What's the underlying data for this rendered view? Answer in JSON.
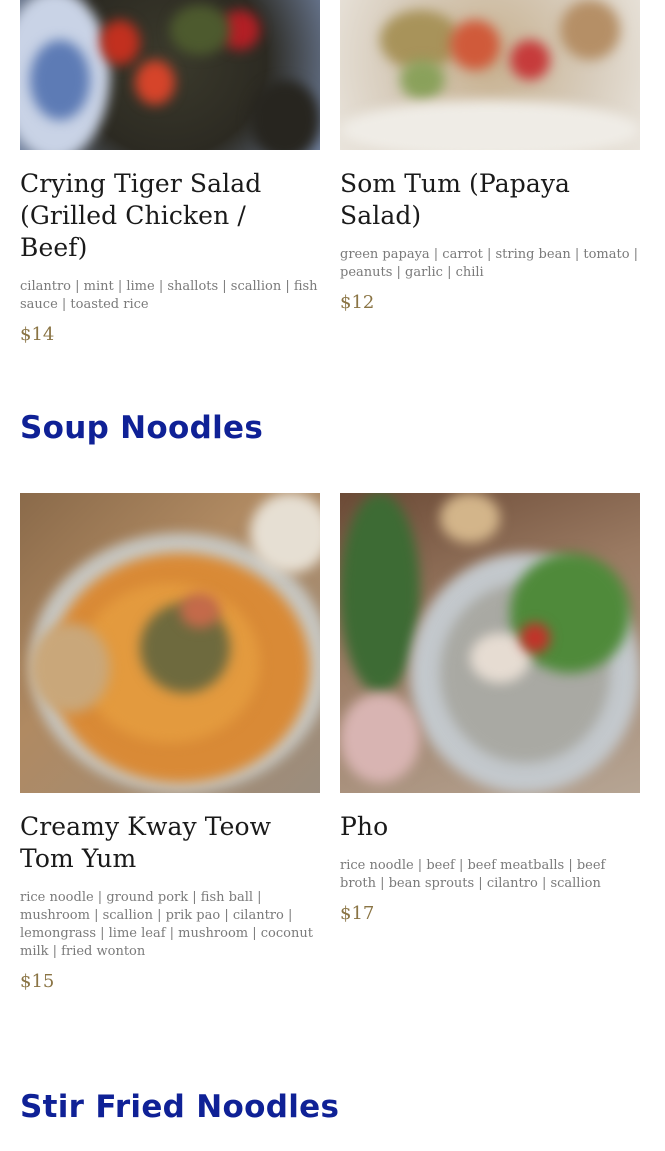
{
  "colors": {
    "heading": "#0f2196",
    "price": "#8a7444",
    "description": "#7a7a7a",
    "title": "#1a1a1a"
  },
  "top_items": [
    {
      "name": "Crying Tiger Salad (Grilled Chicken / Beef)",
      "description": "cilantro | mint | lime | shallots | scallion | fish sauce | toasted rice",
      "price": "$14",
      "image": "crying-tiger-salad-photo"
    },
    {
      "name": "Som Tum (Papaya Salad)",
      "description": "green papaya | carrot | string bean | tomato | peanuts | garlic | chili",
      "price": "$12",
      "image": "som-tum-photo"
    }
  ],
  "soup_noodles": {
    "heading": "Soup Noodles",
    "items": [
      {
        "name": "Creamy Kway Teow Tom Yum",
        "description": "rice noodle | ground pork | fish ball | mushroom | scallion | prik pao | cilantro | lemongrass | lime leaf | mushroom | coconut milk | fried wonton",
        "price": "$15",
        "image": "kway-teow-tom-yum-photo"
      },
      {
        "name": "Pho",
        "description": "rice noodle | beef | beef meatballs | beef broth | bean sprouts | cilantro | scallion",
        "price": "$17",
        "image": "pho-photo"
      }
    ]
  },
  "stir_fried_noodles": {
    "heading": "Stir Fried Noodles"
  }
}
